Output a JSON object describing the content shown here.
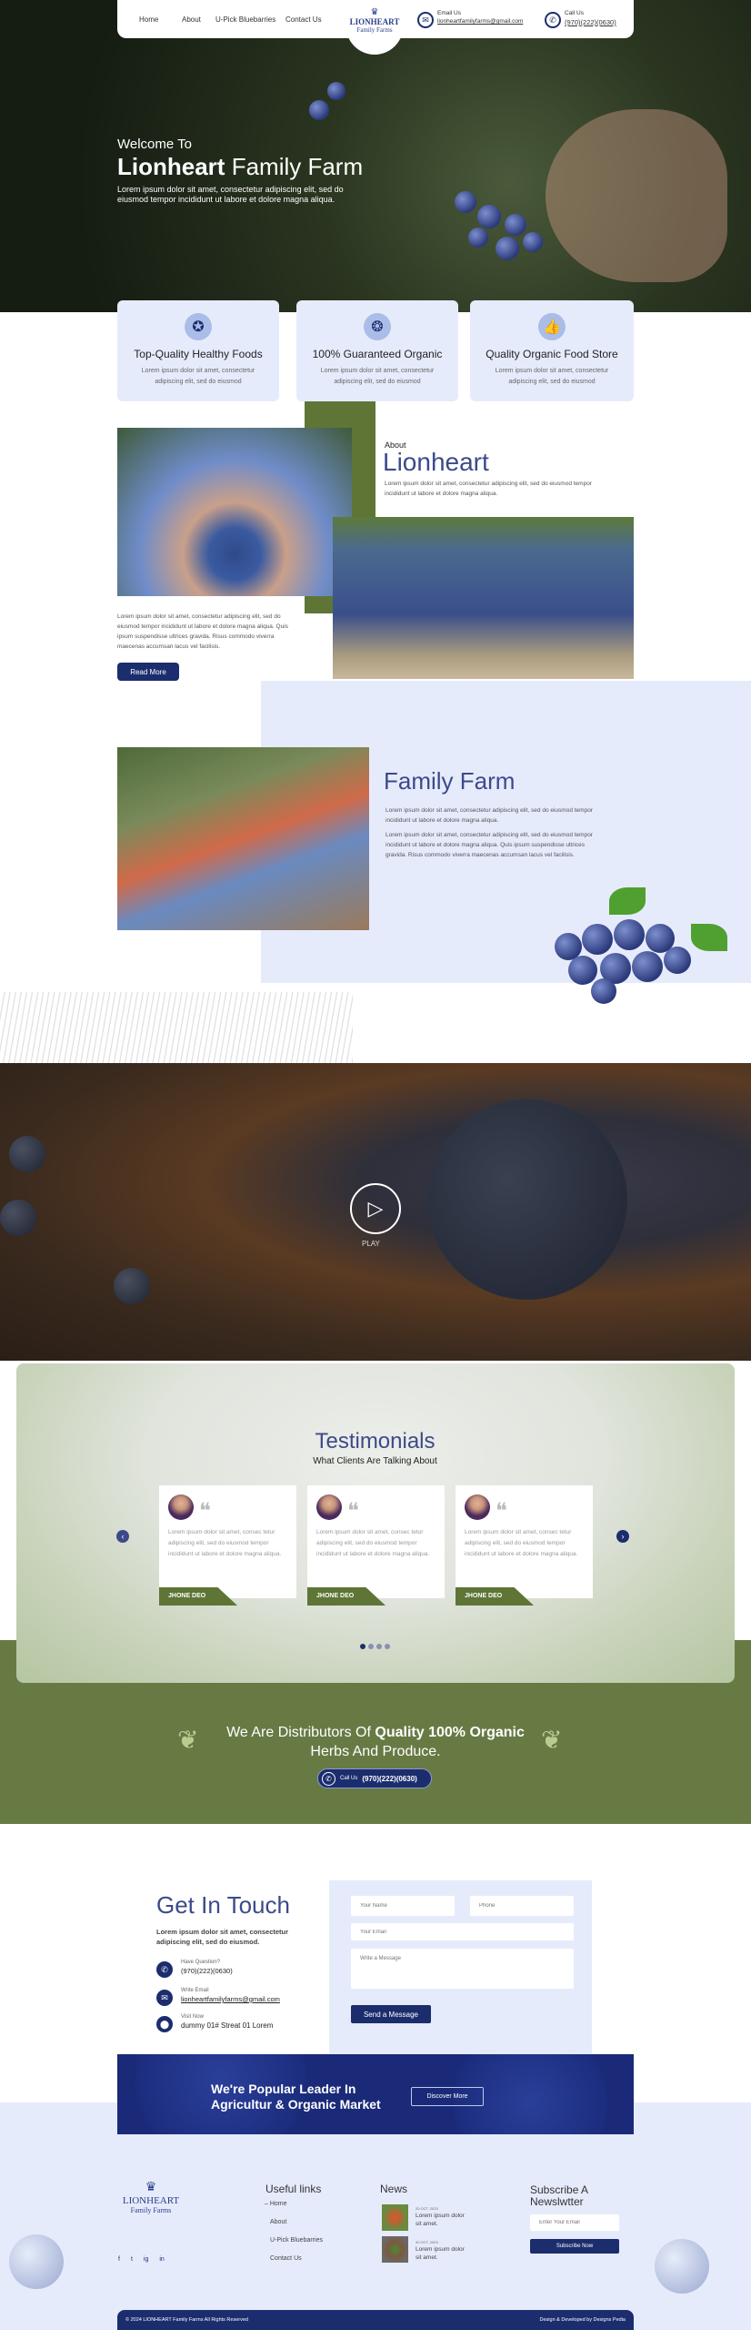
{
  "nav": {
    "items": [
      "Home",
      "About",
      "U-Pick Bluebarries",
      "Contact Us"
    ]
  },
  "logo": {
    "line1": "LIONHEART",
    "line2": "Family Farms"
  },
  "contact_header": {
    "email_label": "Email Us",
    "email": "lionheartfamilyfarms@gmail.com",
    "call_label": "Call Us",
    "phone": "(970)(222)(0630)"
  },
  "hero": {
    "welcome": "Welcome To",
    "title_bold": "Lionheart",
    "title_light": "Family Farm",
    "text": "Lorem ipsum dolor sit amet, consectetur adipiscing elit, sed do eiusmod tempor incididunt ut labore et dolore magna aliqua."
  },
  "features": [
    {
      "icon": "award-ribbon-icon",
      "title": "Top-Quality Healthy Foods",
      "text": "Lorem ipsum dolor sit amet, consectetur adipiscing elit, sed do eiusmod"
    },
    {
      "icon": "natural-badge-icon",
      "title": "100% Guaranteed Organic",
      "text": "Lorem ipsum dolor sit amet, consectetur adipiscing elit, sed do eiusmod"
    },
    {
      "icon": "thumbs-up-stars-icon",
      "title": "Quality Organic Food Store",
      "text": "Lorem ipsum dolor sit amet, consectetur adipiscing elit, sed do eiusmod"
    }
  ],
  "about": {
    "eyebrow": "About",
    "title": "Lionheart",
    "text": "Lorem ipsum dolor sit amet, consectetur adipiscing elit, sed do eiusmod tempor incididunt ut labore et dolore magna aliqua.",
    "para": "Lorem ipsum dolor sit amet, consectetur adipiscing elit, sed do eiusmod tempor incididunt ut labore et dolore magna aliqua. Quis ipsum suspendisse ultrices gravida. Risus commodo viverra maecenas accumsan lacus vel facilisis.",
    "button": "Read More"
  },
  "family": {
    "title": "Family Farm",
    "text1": "Lorem ipsum dolor sit amet, consectetur adipiscing elit, sed do eiusmod tempor incididunt ut labore et dolore magna aliqua.",
    "text2": "Lorem ipsum dolor sit amet, consectetur adipiscing elit, sed do eiusmod tempor incididunt ut labore et dolore magna aliqua. Quis ipsum suspendisse ultrices gravida. Risus commodo viverra maecenas accumsan lacus vel facilisis."
  },
  "video": {
    "play_label": "PLAY"
  },
  "testimonials": {
    "title": "Testimonials",
    "subtitle": "What Clients Are Talking About",
    "items": [
      {
        "text": "Lorem ipsum dolor sit amet, consec tetur adipiscing elit, sed do eiusmod tempor incididunt ut labore et dolore magna aliqua.",
        "name": "JHONE DEO"
      },
      {
        "text": "Lorem ipsum dolor sit amet, consec tetur adipiscing elit, sed do eiusmod tempor incididunt ut labore et dolore magna aliqua.",
        "name": "JHONE DEO"
      },
      {
        "text": "Lorem ipsum dolor sit amet, consec tetur adipiscing elit, sed do eiusmod tempor incididunt ut labore et dolore magna aliqua.",
        "name": "JHONE DEO"
      }
    ]
  },
  "distributor": {
    "line1_light": "We Are Distributors Of",
    "line1_bold": "Quality 100% Organic",
    "line2": "Herbs And Produce.",
    "call_label": "Call Us",
    "phone": "(970)(222)(0630)"
  },
  "contact": {
    "title": "Get In Touch",
    "text": "Lorem ipsum dolor sit amet, consectetur adipiscing elit, sed do eiusmod.",
    "items": [
      {
        "label": "Have Question?",
        "value": "(970)(222)(0630)"
      },
      {
        "label": "Write Email",
        "value": "lionheartfamilyfarms@gmail.com"
      },
      {
        "label": "Visit Now",
        "value": "dummy 01# Streat 01 Lorem"
      }
    ],
    "form": {
      "name_placeholder": "Your Name",
      "phone_placeholder": "Phone",
      "email_placeholder": "Your Email",
      "message_placeholder": "Write a Message",
      "submit": "Send a Message"
    }
  },
  "banner": {
    "line1": "We're Popular Leader In",
    "line2": "Agricultur & Organic Market",
    "button": "Discover More"
  },
  "footer": {
    "useful_title": "Useful links",
    "links": [
      "Home",
      "About",
      "U-Pick Bluebarries",
      "Contact Us"
    ],
    "news_title": "News",
    "news": [
      {
        "date": "20 OCT, 2023",
        "text": "Lorem ipsum dolor sit amet."
      },
      {
        "date": "20 OCT, 2023",
        "text": "Lorem ipsum dolor sit amet."
      }
    ],
    "subscribe_title": "Subscribe A Newslwtter",
    "email_placeholder": "Enter Your Email",
    "subscribe_button": "Subscribe Now",
    "social": [
      "f",
      "t",
      "ig",
      "in"
    ],
    "copyright": "© 2024 LIONHEART Family Farms All Rights Reserved",
    "credit": "Design & Developed by Designs Pedia"
  },
  "colors": {
    "navy": "#1c2d6e",
    "green": "#5e7536",
    "lavender": "#e6ebfc"
  }
}
